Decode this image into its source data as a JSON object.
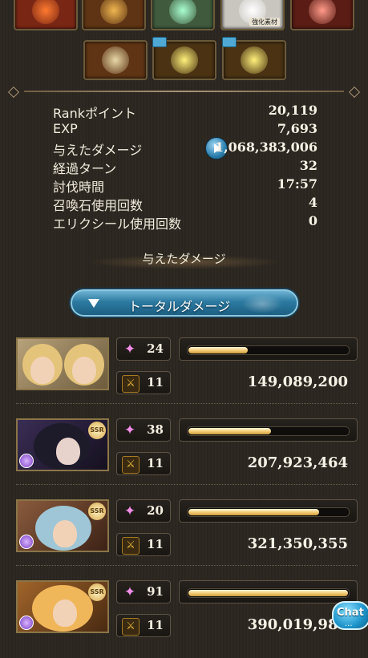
{
  "loot_row1": [
    {
      "name": "red-crystal",
      "color": "#7a2614",
      "glow": "#ff7a30",
      "tag": ""
    },
    {
      "name": "gold-item",
      "color": "#5e3414",
      "glow": "#f0b650",
      "tag": ""
    },
    {
      "name": "green-orb",
      "color": "#3f5a3c",
      "glow": "#a8ffd0",
      "tag": ""
    },
    {
      "name": "material",
      "color": "#c9c6c0",
      "glow": "#ffffff",
      "tag": "強化素材"
    },
    {
      "name": "red-orb",
      "color": "#5a1c14",
      "glow": "#ff9a8a",
      "tag": ""
    }
  ],
  "loot_row2": [
    {
      "name": "scroll",
      "color": "#5e3414",
      "glow": "#e8d8a8",
      "chest": false
    },
    {
      "name": "gold-ring",
      "color": "#4a3212",
      "glow": "#fff07a",
      "chest": true
    },
    {
      "name": "gold-ring-2",
      "color": "#4a3212",
      "glow": "#fff07a",
      "chest": true
    }
  ],
  "stats": [
    {
      "label": "Rankポイント",
      "value": "20,119"
    },
    {
      "label": "EXP",
      "value": "7,693"
    },
    {
      "label": "与えたダメージ",
      "value": "1,068,383,006"
    },
    {
      "label": "経過ターン",
      "value": "32"
    },
    {
      "label": "討伐時間",
      "value": "17:57"
    },
    {
      "label": "召喚石使用回数",
      "value": "4"
    },
    {
      "label": "エリクシール使用回数",
      "value": "0"
    }
  ],
  "section_title": "与えたダメージ",
  "dropdown_label": "トータルダメージ",
  "characters": [
    {
      "ability": "24",
      "turns": "11",
      "damage": "149,089,200",
      "bar_fraction": 0.37,
      "ssr": false,
      "element": false,
      "theme": "#8c7a55"
    },
    {
      "ability": "38",
      "turns": "11",
      "damage": "207,923,464",
      "bar_fraction": 0.52,
      "ssr": true,
      "element": true,
      "theme": "#2a1f3c"
    },
    {
      "ability": "20",
      "turns": "11",
      "damage": "321,350,355",
      "bar_fraction": 0.82,
      "ssr": true,
      "element": true,
      "theme": "#5f3a2a"
    },
    {
      "ability": "91",
      "turns": "11",
      "damage": "390,019,987",
      "bar_fraction": 1.0,
      "ssr": true,
      "element": true,
      "theme": "#6b3d1f"
    }
  ],
  "ssr_label": "SSR",
  "chat": {
    "label": "Chat",
    "dots": "..."
  }
}
